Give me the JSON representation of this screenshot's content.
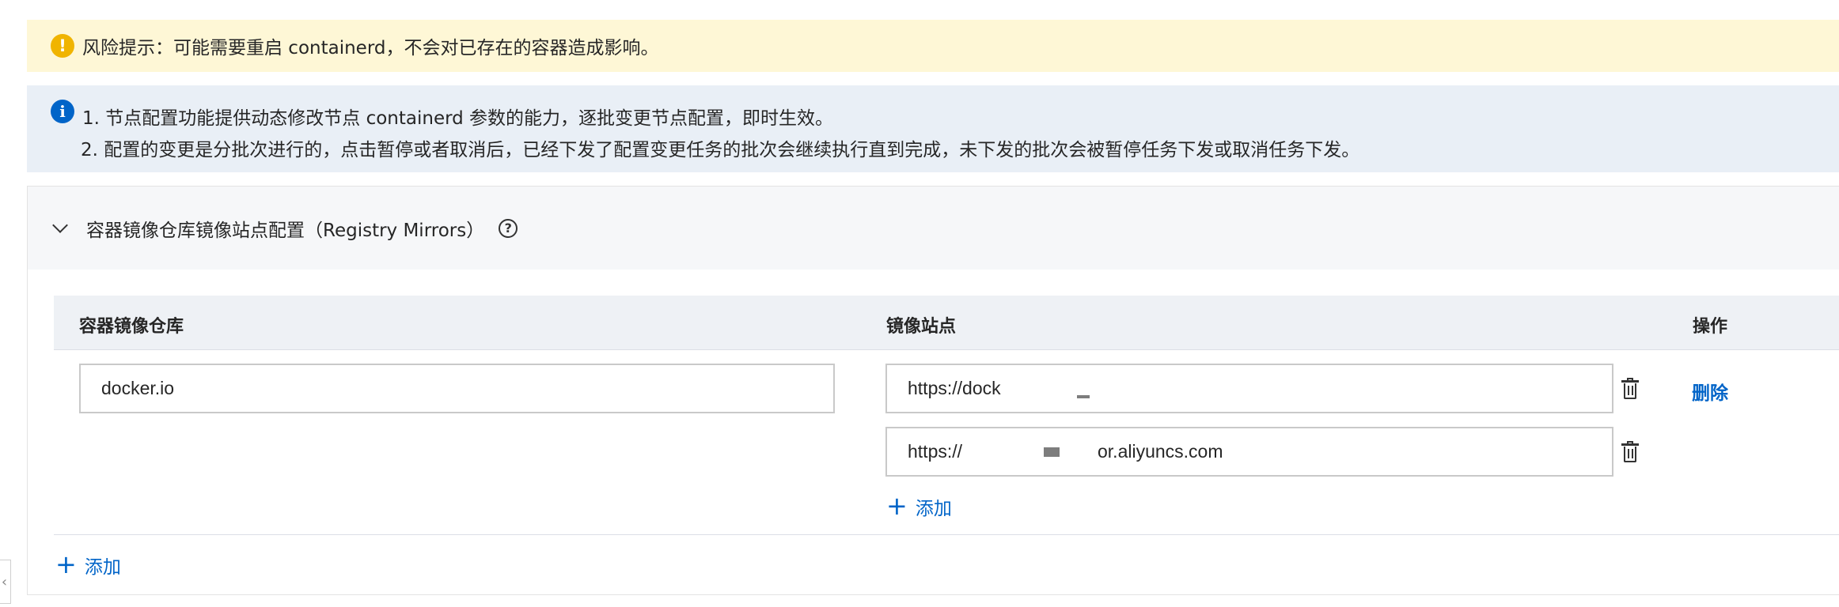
{
  "warning": {
    "icon": "warning-icon",
    "text": "风险提示：可能需要重启 containerd，不会对已存在的容器造成影响。",
    "color": "#f0b400"
  },
  "info": {
    "icon": "info-icon",
    "line1": "1. 节点配置功能提供动态修改节点 containerd 参数的能力，逐批变更节点配置，即时生效。",
    "line2": "2. 配置的变更是分批次进行的，点击暂停或者取消后，已经下发了配置变更任务的批次会继续执行直到完成，未下发的批次会被暂停任务下发或取消任务下发。",
    "color": "#0064c8"
  },
  "panel": {
    "title": "容器镜像仓库镜像站点配置（Registry Mirrors）",
    "help_icon": "help-icon",
    "collapse_icon": "chevron-down-icon"
  },
  "table": {
    "columns": [
      "容器镜像仓库",
      "镜像站点",
      "操作"
    ],
    "rows": [
      {
        "registry": "docker.io",
        "mirrors": [
          "https://dock",
          "https://",
          "or.aliyuncs.com"
        ],
        "action": "删除"
      }
    ],
    "add_mirror_label": "添加",
    "add_row_label": "添加"
  },
  "accent_color": "#0064c8"
}
